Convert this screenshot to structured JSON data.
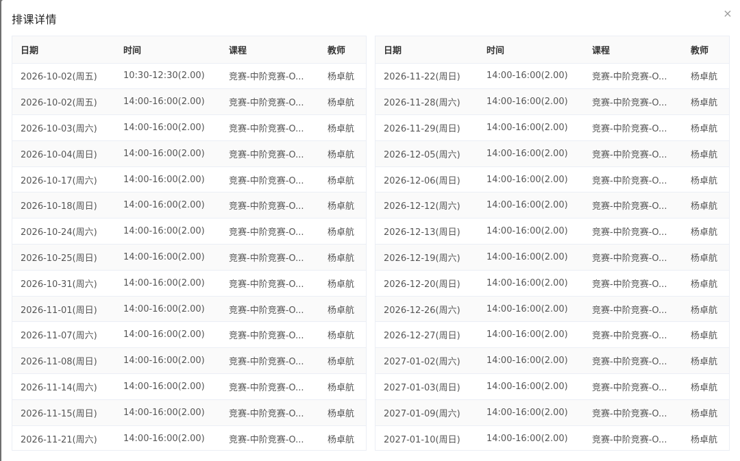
{
  "dialog": {
    "title": "排课详情",
    "close_glyph": "×"
  },
  "columns": {
    "date": "日期",
    "time": "时间",
    "course": "课程",
    "teacher": "教师"
  },
  "tables": [
    {
      "rows": [
        {
          "date": "2026-10-02(周五)",
          "time": "10:30-12:30(2.00)",
          "course": "竞赛-中阶竞赛-O...",
          "teacher": "杨卓航"
        },
        {
          "date": "2026-10-02(周五)",
          "time": "14:00-16:00(2.00)",
          "course": "竞赛-中阶竞赛-O...",
          "teacher": "杨卓航"
        },
        {
          "date": "2026-10-03(周六)",
          "time": "14:00-16:00(2.00)",
          "course": "竞赛-中阶竞赛-O...",
          "teacher": "杨卓航"
        },
        {
          "date": "2026-10-04(周日)",
          "time": "14:00-16:00(2.00)",
          "course": "竞赛-中阶竞赛-O...",
          "teacher": "杨卓航"
        },
        {
          "date": "2026-10-17(周六)",
          "time": "14:00-16:00(2.00)",
          "course": "竞赛-中阶竞赛-O...",
          "teacher": "杨卓航"
        },
        {
          "date": "2026-10-18(周日)",
          "time": "14:00-16:00(2.00)",
          "course": "竞赛-中阶竞赛-O...",
          "teacher": "杨卓航"
        },
        {
          "date": "2026-10-24(周六)",
          "time": "14:00-16:00(2.00)",
          "course": "竞赛-中阶竞赛-O...",
          "teacher": "杨卓航"
        },
        {
          "date": "2026-10-25(周日)",
          "time": "14:00-16:00(2.00)",
          "course": "竞赛-中阶竞赛-O...",
          "teacher": "杨卓航"
        },
        {
          "date": "2026-10-31(周六)",
          "time": "14:00-16:00(2.00)",
          "course": "竞赛-中阶竞赛-O...",
          "teacher": "杨卓航"
        },
        {
          "date": "2026-11-01(周日)",
          "time": "14:00-16:00(2.00)",
          "course": "竞赛-中阶竞赛-O...",
          "teacher": "杨卓航"
        },
        {
          "date": "2026-11-07(周六)",
          "time": "14:00-16:00(2.00)",
          "course": "竞赛-中阶竞赛-O...",
          "teacher": "杨卓航"
        },
        {
          "date": "2026-11-08(周日)",
          "time": "14:00-16:00(2.00)",
          "course": "竞赛-中阶竞赛-O...",
          "teacher": "杨卓航"
        },
        {
          "date": "2026-11-14(周六)",
          "time": "14:00-16:00(2.00)",
          "course": "竞赛-中阶竞赛-O...",
          "teacher": "杨卓航"
        },
        {
          "date": "2026-11-15(周日)",
          "time": "14:00-16:00(2.00)",
          "course": "竞赛-中阶竞赛-O...",
          "teacher": "杨卓航"
        },
        {
          "date": "2026-11-21(周六)",
          "time": "14:00-16:00(2.00)",
          "course": "竞赛-中阶竞赛-O...",
          "teacher": "杨卓航"
        }
      ]
    },
    {
      "rows": [
        {
          "date": "2026-11-22(周日)",
          "time": "14:00-16:00(2.00)",
          "course": "竞赛-中阶竞赛-O...",
          "teacher": "杨卓航"
        },
        {
          "date": "2026-11-28(周六)",
          "time": "14:00-16:00(2.00)",
          "course": "竞赛-中阶竞赛-O...",
          "teacher": "杨卓航"
        },
        {
          "date": "2026-11-29(周日)",
          "time": "14:00-16:00(2.00)",
          "course": "竞赛-中阶竞赛-O...",
          "teacher": "杨卓航"
        },
        {
          "date": "2026-12-05(周六)",
          "time": "14:00-16:00(2.00)",
          "course": "竞赛-中阶竞赛-O...",
          "teacher": "杨卓航"
        },
        {
          "date": "2026-12-06(周日)",
          "time": "14:00-16:00(2.00)",
          "course": "竞赛-中阶竞赛-O...",
          "teacher": "杨卓航"
        },
        {
          "date": "2026-12-12(周六)",
          "time": "14:00-16:00(2.00)",
          "course": "竞赛-中阶竞赛-O...",
          "teacher": "杨卓航"
        },
        {
          "date": "2026-12-13(周日)",
          "time": "14:00-16:00(2.00)",
          "course": "竞赛-中阶竞赛-O...",
          "teacher": "杨卓航"
        },
        {
          "date": "2026-12-19(周六)",
          "time": "14:00-16:00(2.00)",
          "course": "竞赛-中阶竞赛-O...",
          "teacher": "杨卓航"
        },
        {
          "date": "2026-12-20(周日)",
          "time": "14:00-16:00(2.00)",
          "course": "竞赛-中阶竞赛-O...",
          "teacher": "杨卓航"
        },
        {
          "date": "2026-12-26(周六)",
          "time": "14:00-16:00(2.00)",
          "course": "竞赛-中阶竞赛-O...",
          "teacher": "杨卓航"
        },
        {
          "date": "2026-12-27(周日)",
          "time": "14:00-16:00(2.00)",
          "course": "竞赛-中阶竞赛-O...",
          "teacher": "杨卓航"
        },
        {
          "date": "2027-01-02(周六)",
          "time": "14:00-16:00(2.00)",
          "course": "竞赛-中阶竞赛-O...",
          "teacher": "杨卓航"
        },
        {
          "date": "2027-01-03(周日)",
          "time": "14:00-16:00(2.00)",
          "course": "竞赛-中阶竞赛-O...",
          "teacher": "杨卓航"
        },
        {
          "date": "2027-01-09(周六)",
          "time": "14:00-16:00(2.00)",
          "course": "竞赛-中阶竞赛-O...",
          "teacher": "杨卓航"
        },
        {
          "date": "2027-01-10(周日)",
          "time": "14:00-16:00(2.00)",
          "course": "竞赛-中阶竞赛-O...",
          "teacher": "杨卓航"
        }
      ]
    }
  ]
}
